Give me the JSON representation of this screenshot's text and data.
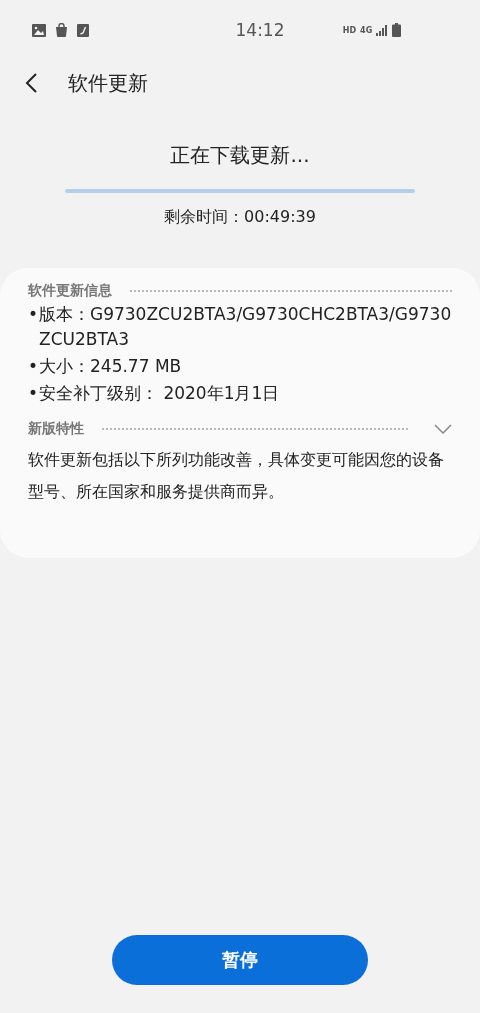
{
  "status_bar": {
    "time": "14:12",
    "network": "HD",
    "network_type": "4G"
  },
  "header": {
    "title": "软件更新"
  },
  "download": {
    "title": "正在下载更新...",
    "level": 0,
    "remaining": "剩余时间：00:49:39"
  },
  "info": {
    "heading": "软件更新信息",
    "items": [
      {
        "bullet": "•",
        "text": "版本：G9730ZCU2BTA3/G9730CHC2BTA3/G9730ZCU2BTA3"
      },
      {
        "bullet": "•",
        "text": "大小：245.77 MB"
      },
      {
        "bullet": "•",
        "text": "安全补丁级别： 2020年1月1日"
      }
    ]
  },
  "features": {
    "heading": "新版特性",
    "text": "软件更新包括以下所列功能改善，具体变更可能因您的设备型号、所在国家和服务提供商而异。"
  },
  "button": {
    "label": "暂停"
  }
}
